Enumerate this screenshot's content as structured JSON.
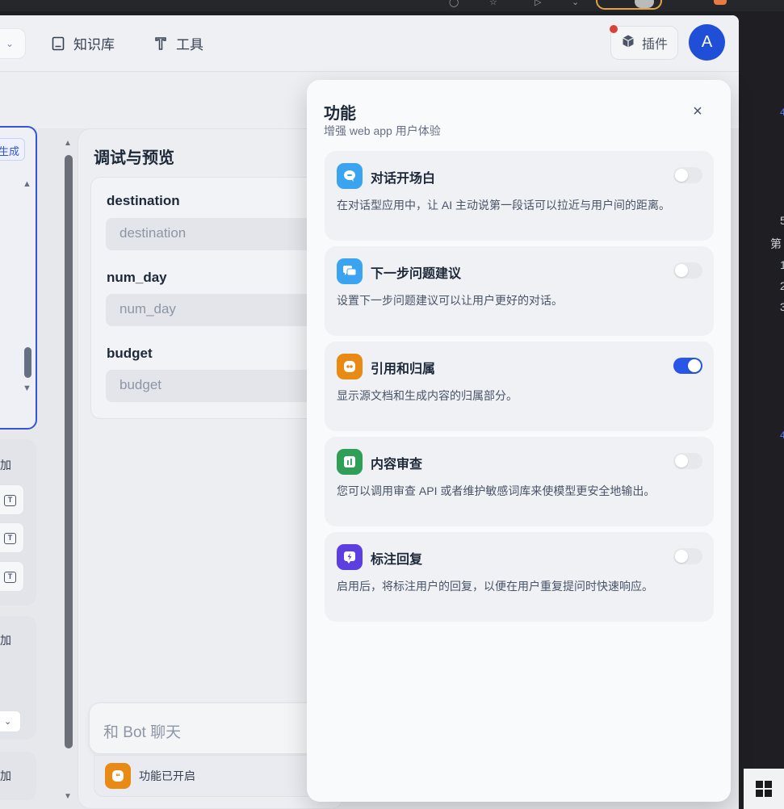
{
  "header": {
    "nav": [
      {
        "label": "知识库",
        "icon": "book-icon"
      },
      {
        "label": "工具",
        "icon": "tool-icon"
      }
    ],
    "plugin_label": "插件",
    "avatar_letter": "A"
  },
  "left": {
    "gen_label": "生成",
    "add_labels": [
      "加",
      "加",
      "加"
    ]
  },
  "debug": {
    "title": "调试与预览",
    "variables": [
      {
        "label": "destination",
        "placeholder": "destination"
      },
      {
        "label": "num_day",
        "placeholder": "num_day"
      },
      {
        "label": "budget",
        "placeholder": "budget"
      }
    ],
    "chat_placeholder": "和 Bot 聊天",
    "feature_enabled_label": "功能已开启"
  },
  "modal": {
    "title": "功能",
    "subtitle": "增强 web app 用户体验",
    "features": [
      {
        "name": "对话开场白",
        "description": "在对话型应用中，让 AI 主动说第一段话可以拉近与用户间的距离。",
        "enabled": false,
        "icon": "chat-bubble-icon",
        "color": "#3aa4f0"
      },
      {
        "name": "下一步问题建议",
        "description": "设置下一步问题建议可以让用户更好的对话。",
        "enabled": false,
        "icon": "chat-suggest-icon",
        "color": "#3aa4f0"
      },
      {
        "name": "引用和归属",
        "description": "显示源文档和生成内容的归属部分。",
        "enabled": true,
        "icon": "quote-icon",
        "color": "#e88a13"
      },
      {
        "name": "内容审查",
        "description": "您可以调用审查 API 或者维护敏感词库来使模型更安全地输出。",
        "enabled": false,
        "icon": "moderation-icon",
        "color": "#2f9e57"
      },
      {
        "name": "标注回复",
        "description": "启用后，将标注用户的回复，以便在用户重复提问时快速响应。",
        "enabled": false,
        "icon": "annotation-reply-icon",
        "color": "#5b3fe0"
      }
    ]
  },
  "right_edge": {
    "glyphs": [
      "5",
      "第",
      "1",
      "2",
      "3"
    ]
  }
}
